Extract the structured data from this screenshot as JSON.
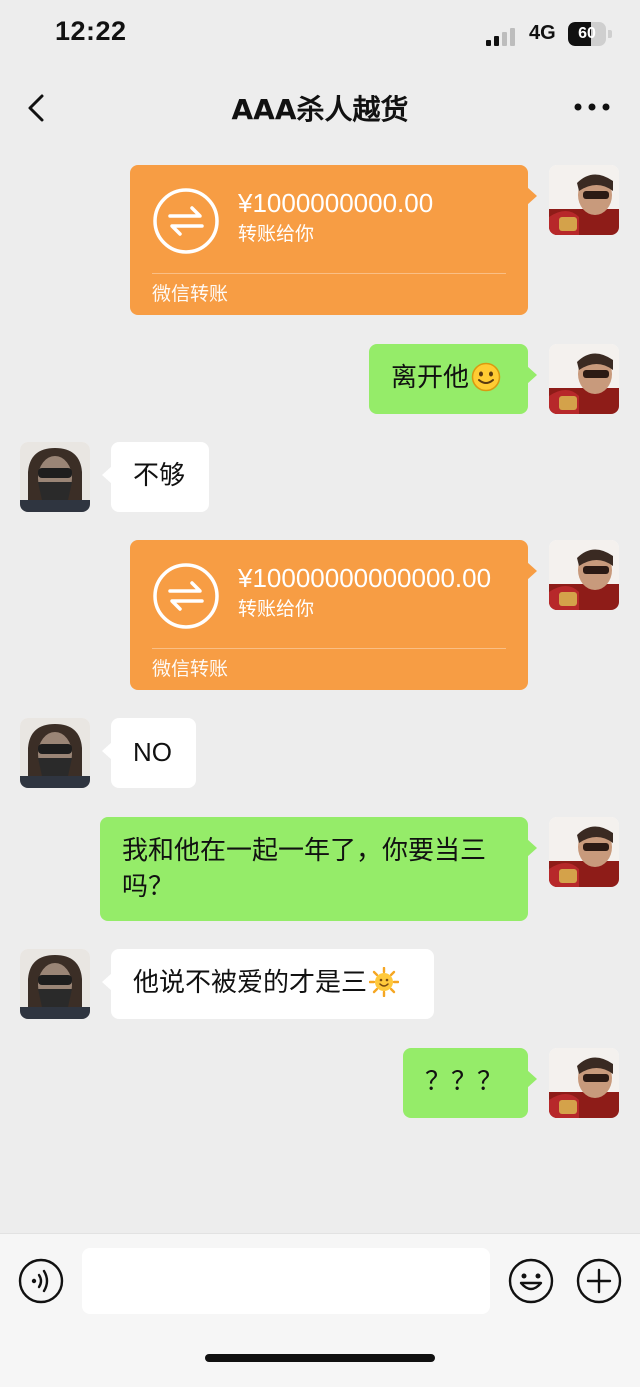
{
  "status_bar": {
    "time": "12:22",
    "network": "4G",
    "battery": "60",
    "battery_level": 0.6
  },
  "nav": {
    "title": "AAA杀人越货",
    "back_icon": "chevron-left-icon",
    "more_icon": "more-dots-icon"
  },
  "messages": [
    {
      "from": "me",
      "type": "transfer",
      "amount": "¥1000000000.00",
      "note": "转账给你",
      "footer": "微信转账"
    },
    {
      "from": "me",
      "type": "text",
      "text": "离开他",
      "emoji": "smiling-face-icon"
    },
    {
      "from": "other",
      "type": "text",
      "text": "不够"
    },
    {
      "from": "me",
      "type": "transfer",
      "amount": "¥10000000000000.00",
      "note": "转账给你",
      "footer": "微信转账"
    },
    {
      "from": "other",
      "type": "text",
      "text": "NO"
    },
    {
      "from": "me",
      "type": "text",
      "text_line1": "我和他在一起一年了，你要当三",
      "text_line2": "吗？"
    },
    {
      "from": "other",
      "type": "text",
      "text": "他说不被爱的才是三",
      "emoji": "sun-face-icon"
    },
    {
      "from": "me",
      "type": "text",
      "text": "？？？"
    }
  ],
  "input_bar": {
    "voice_icon": "voice-icon",
    "emoji_icon": "emoji-icon",
    "plus_icon": "plus-icon"
  },
  "colors": {
    "background": "#ededed",
    "my_bubble": "#95ec69",
    "their_bubble": "#ffffff",
    "transfer": "#f79d44"
  }
}
